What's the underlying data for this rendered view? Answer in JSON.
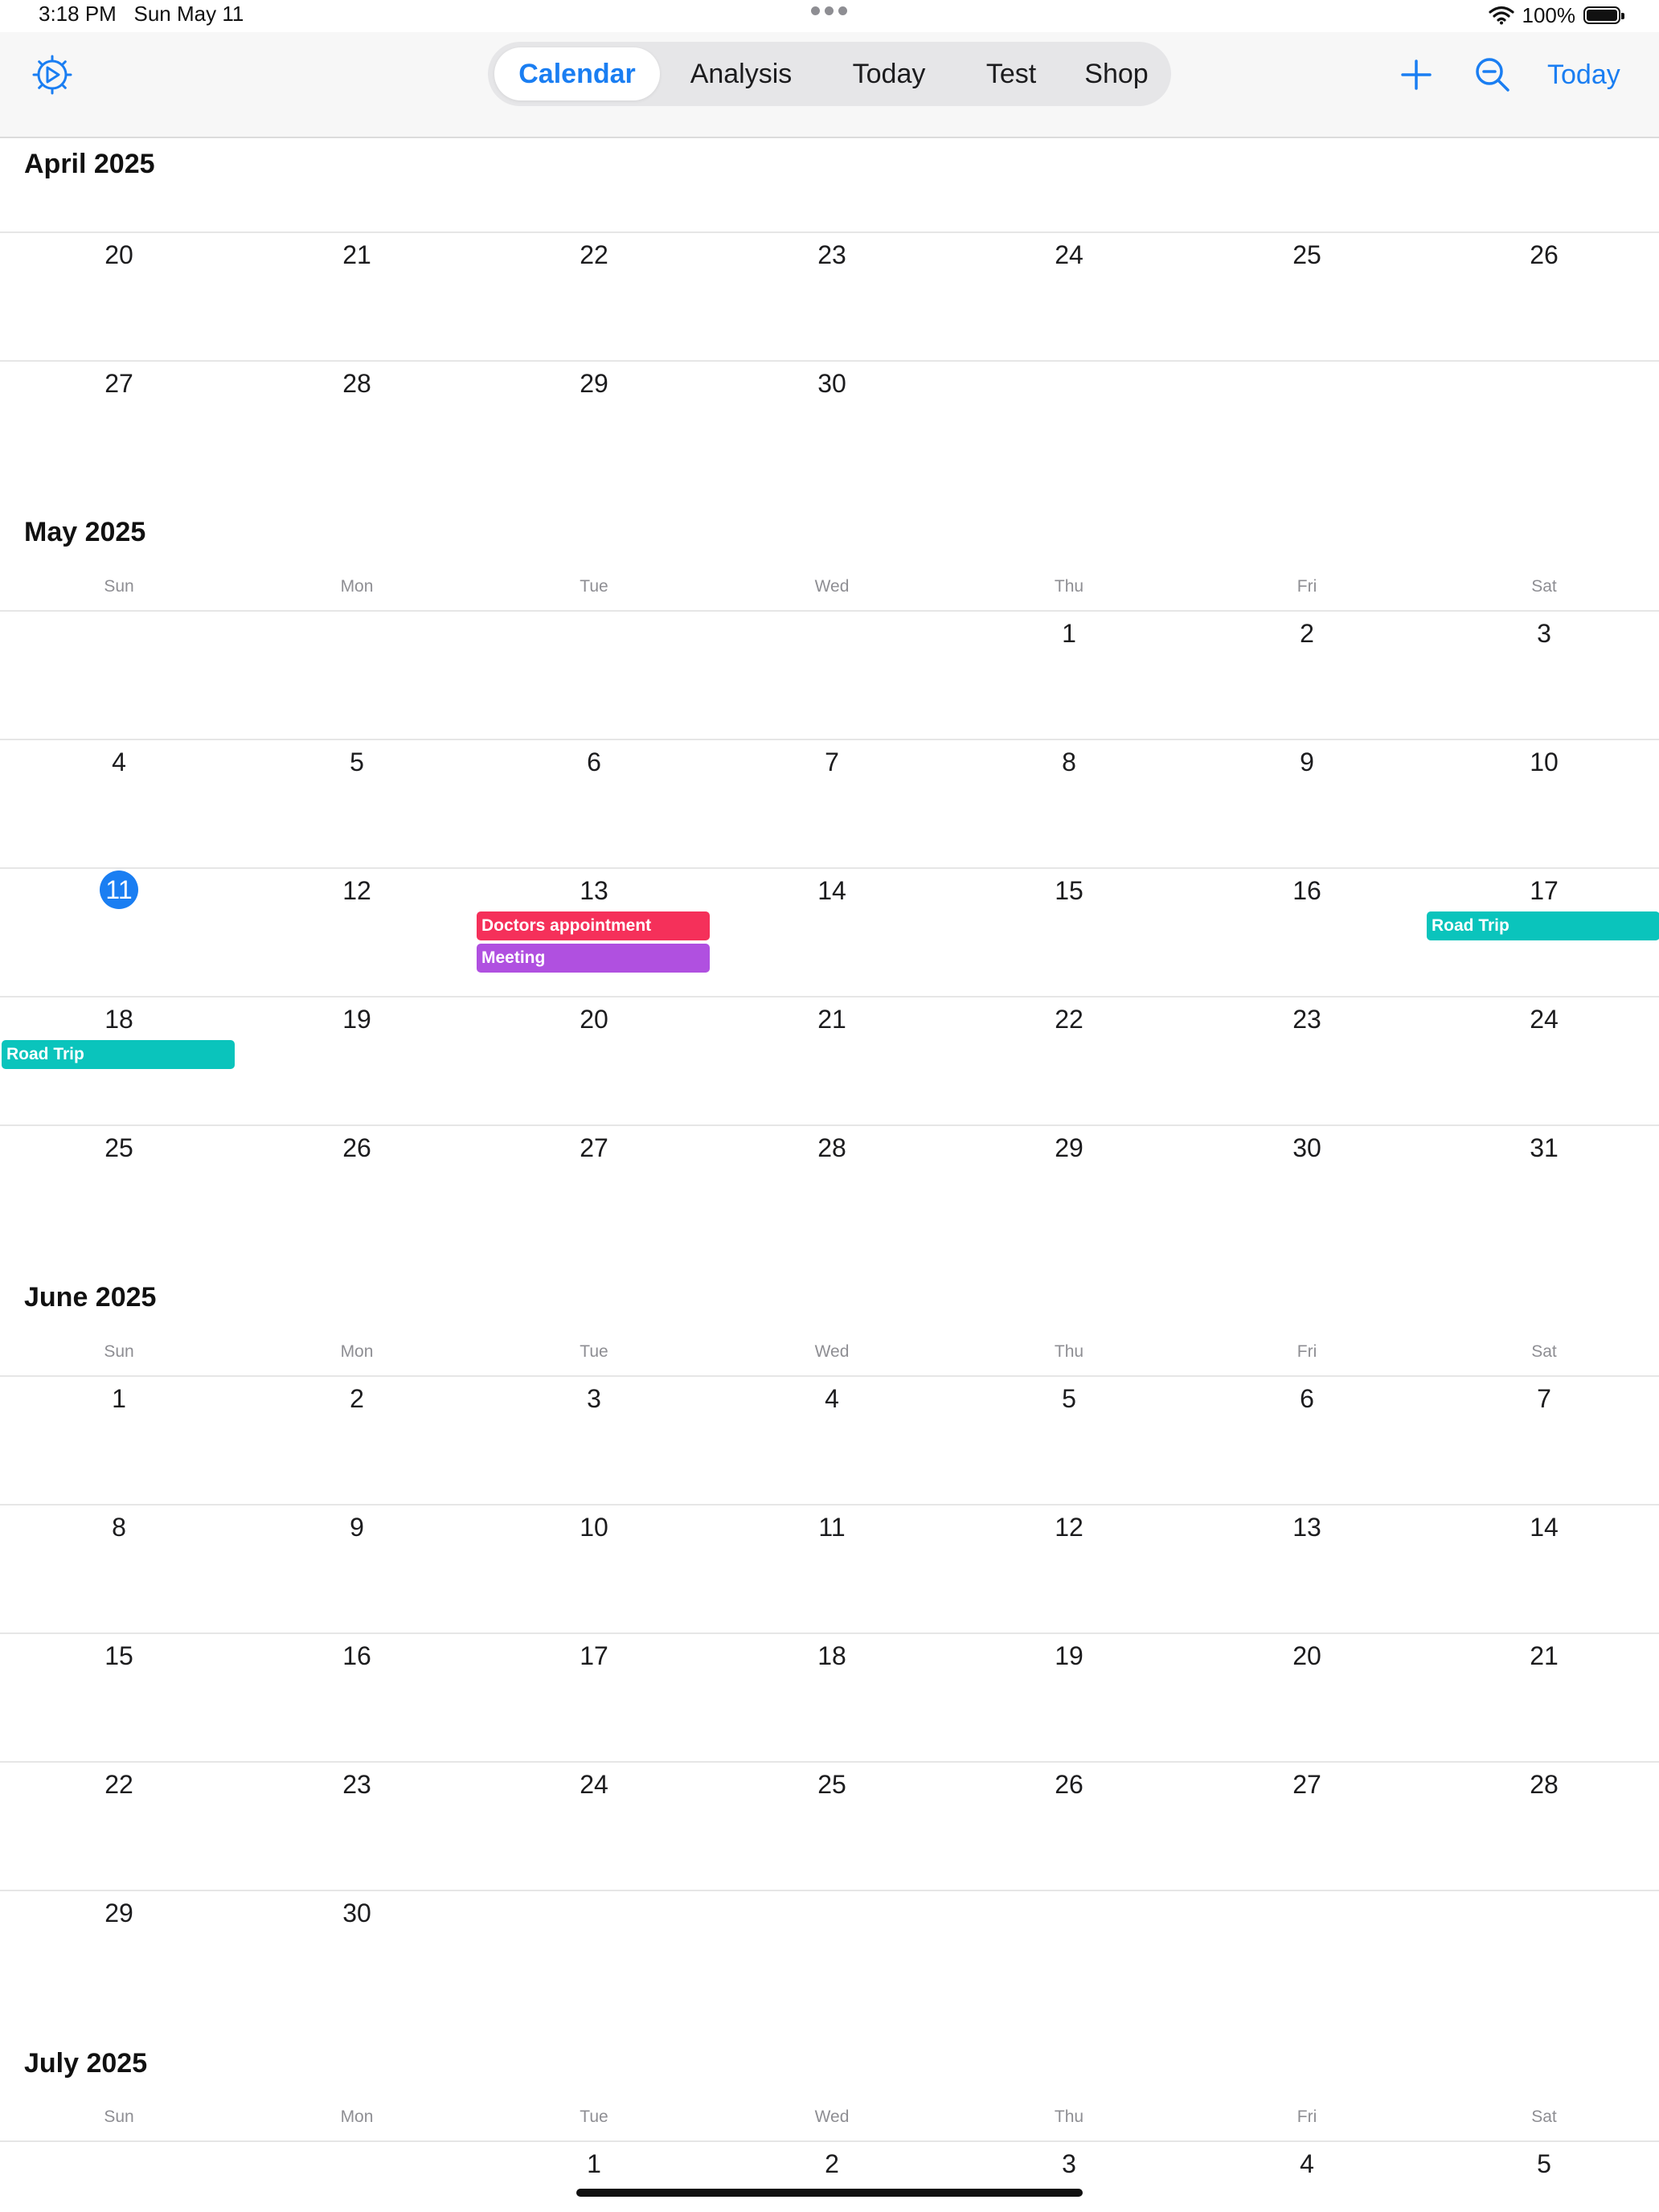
{
  "status_bar": {
    "time": "3:18 PM",
    "date": "Sun May 11",
    "battery": "100%"
  },
  "toolbar": {
    "tabs": [
      {
        "label": "Calendar",
        "active": true
      },
      {
        "label": "Analysis",
        "active": false
      },
      {
        "label": "Today",
        "active": false
      },
      {
        "label": "Test",
        "active": false
      },
      {
        "label": "Shop",
        "active": false
      }
    ],
    "icons": [
      "gear-icon",
      "plus-icon",
      "zoom-out-icon"
    ],
    "today_button": "Today",
    "accent_color": "#1a7ef2"
  },
  "weekday_labels": [
    "Sun",
    "Mon",
    "Tue",
    "Wed",
    "Thu",
    "Fri",
    "Sat"
  ],
  "months": [
    {
      "title": "April 2025",
      "weeks": [
        [
          "20",
          "21",
          "22",
          "23",
          "24",
          "25",
          "26"
        ],
        [
          "27",
          "28",
          "29",
          "30",
          "",
          "",
          ""
        ]
      ]
    },
    {
      "title": "May 2025",
      "weeks": [
        [
          "",
          "",
          "",
          "",
          "1",
          "2",
          "3"
        ],
        [
          "4",
          "5",
          "6",
          "7",
          "8",
          "9",
          "10"
        ],
        [
          "11",
          "12",
          "13",
          "14",
          "15",
          "16",
          "17"
        ],
        [
          "18",
          "19",
          "20",
          "21",
          "22",
          "23",
          "24"
        ],
        [
          "25",
          "26",
          "27",
          "28",
          "29",
          "30",
          "31"
        ]
      ]
    },
    {
      "title": "June 2025",
      "weeks": [
        [
          "1",
          "2",
          "3",
          "4",
          "5",
          "6",
          "7"
        ],
        [
          "8",
          "9",
          "10",
          "11",
          "12",
          "13",
          "14"
        ],
        [
          "15",
          "16",
          "17",
          "18",
          "19",
          "20",
          "21"
        ],
        [
          "22",
          "23",
          "24",
          "25",
          "26",
          "27",
          "28"
        ],
        [
          "29",
          "30",
          "",
          "",
          "",
          "",
          ""
        ]
      ]
    },
    {
      "title": "July 2025",
      "weeks": [
        [
          "",
          "",
          "1",
          "2",
          "3",
          "4",
          "5"
        ]
      ]
    }
  ],
  "today": {
    "month": "May 2025",
    "day": "11"
  },
  "events": [
    {
      "title": "Doctors appointment",
      "month": "May 2025",
      "day": "13",
      "color": "#f5305a"
    },
    {
      "title": "Meeting",
      "month": "May 2025",
      "day": "13",
      "color": "#b050e0"
    },
    {
      "title": "Road Trip",
      "month": "May 2025",
      "day": "17",
      "color": "#0ac4bc"
    },
    {
      "title": "Road Trip",
      "month": "May 2025",
      "day": "18",
      "color": "#0ac4bc"
    }
  ]
}
